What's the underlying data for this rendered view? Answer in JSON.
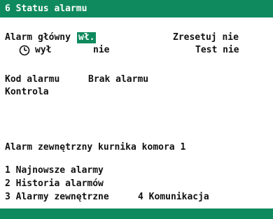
{
  "header": {
    "title": "6 Status alarmu"
  },
  "alarm": {
    "main_label": "Alarm główny",
    "main_value": "wł.",
    "reset_label": "Zresetuj nie",
    "timer_label": "wył",
    "timer_value": "nie",
    "test_label": "Test nie",
    "code_label": "Kod alarmu",
    "code_value": "Brak alarmu",
    "control_label": "Kontrola",
    "external_label": "Alarm zewnętrzny kurnika komora 1"
  },
  "menu": {
    "item1": "1 Najnowsze alarmy",
    "item2": "2 Historia alarmów",
    "item3": "3 Alarmy zewnętrzne",
    "item4": "4 Komunikacja"
  },
  "colors": {
    "accent": "#0f8a5f",
    "text": "#111111",
    "background": "#ffffff"
  },
  "icons": {
    "timer": "clock-icon"
  }
}
